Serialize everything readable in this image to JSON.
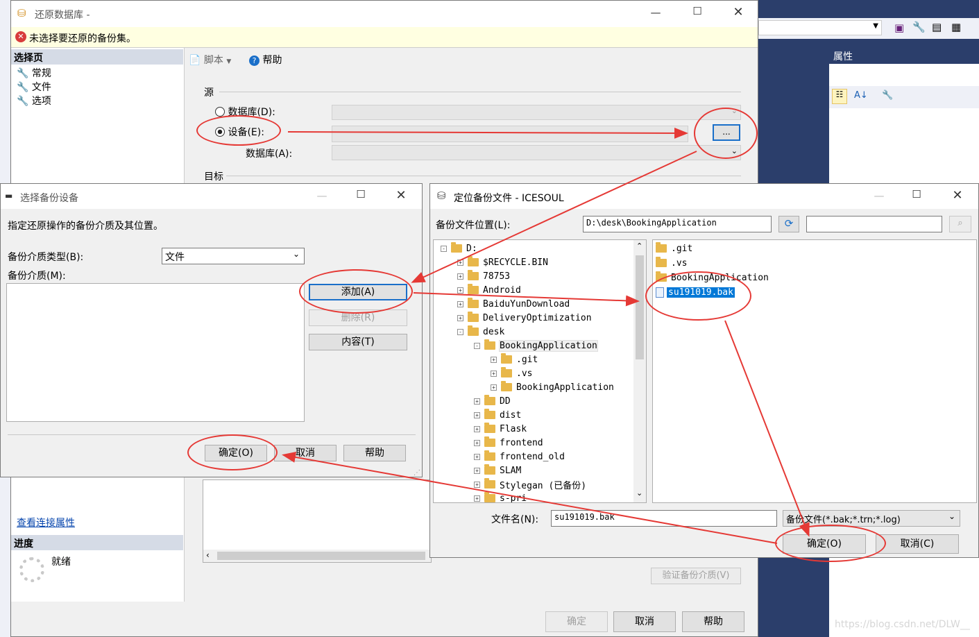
{
  "background_app": {
    "properties_label": "属性"
  },
  "restore_window": {
    "title": "还原数据库 -",
    "error_text": "未选择要还原的备份集。",
    "left_panel": {
      "header": "选择页",
      "pages": [
        "常规",
        "文件",
        "选项"
      ],
      "connection_link": "查看连接属性",
      "progress_header": "进度",
      "progress_status": "就绪"
    },
    "toolbar": {
      "script": "脚本",
      "help": "帮助"
    },
    "source_label": "源",
    "radio_database": "数据库(D):",
    "radio_device": "设备(E):",
    "database_label": "数据库(A):",
    "device_browse": "...",
    "target_label": "目标",
    "verify_button": "验证备份介质(V)",
    "ok": "确定",
    "cancel": "取消",
    "help": "帮助"
  },
  "select_device_dialog": {
    "title": "选择备份设备",
    "instruction": "指定还原操作的备份介质及其位置。",
    "media_type_label": "备份介质类型(B):",
    "media_type_value": "文件",
    "media_label": "备份介质(M):",
    "add": "添加(A)",
    "remove": "删除(R)",
    "contents": "内容(T)",
    "ok": "确定(O)",
    "cancel": "取消",
    "help": "帮助"
  },
  "locate_file_dialog": {
    "title": "定位备份文件 - ICESOUL",
    "location_label": "备份文件位置(L):",
    "location_value": "D:\\desk\\BookingApplication",
    "tree": [
      {
        "label": "D:",
        "level": 0,
        "toggle": "-"
      },
      {
        "label": "$RECYCLE.BIN",
        "level": 1,
        "toggle": "+"
      },
      {
        "label": "78753",
        "level": 1,
        "toggle": "+"
      },
      {
        "label": "Android",
        "level": 1,
        "toggle": "+"
      },
      {
        "label": "BaiduYunDownload",
        "level": 1,
        "toggle": "+"
      },
      {
        "label": "DeliveryOptimization",
        "level": 1,
        "toggle": "+"
      },
      {
        "label": "desk",
        "level": 1,
        "toggle": "-"
      },
      {
        "label": "BookingApplication",
        "level": 2,
        "toggle": "-"
      },
      {
        "label": ".git",
        "level": 3,
        "toggle": "+"
      },
      {
        "label": ".vs",
        "level": 3,
        "toggle": "+"
      },
      {
        "label": "BookingApplication",
        "level": 3,
        "toggle": "+"
      },
      {
        "label": "DD",
        "level": 2,
        "toggle": "+"
      },
      {
        "label": "dist",
        "level": 2,
        "toggle": "+"
      },
      {
        "label": "Flask",
        "level": 2,
        "toggle": "+"
      },
      {
        "label": "frontend",
        "level": 2,
        "toggle": "+"
      },
      {
        "label": "frontend_old",
        "level": 2,
        "toggle": "+"
      },
      {
        "label": "SLAM",
        "level": 2,
        "toggle": "+"
      },
      {
        "label": "Stylegan (已备份)",
        "level": 2,
        "toggle": "+"
      },
      {
        "label": "s-pri",
        "level": 2,
        "toggle": "+"
      }
    ],
    "files": [
      {
        "label": ".git",
        "kind": "folder"
      },
      {
        "label": ".vs",
        "kind": "folder"
      },
      {
        "label": "BookingApplication",
        "kind": "folder"
      },
      {
        "label": "su191019.bak",
        "kind": "file",
        "selected": true
      }
    ],
    "filename_label": "文件名(N):",
    "filename_value": "su191019.bak",
    "filter_value": "备份文件(*.bak;*.trn;*.log)",
    "ok": "确定(O)",
    "cancel": "取消(C)"
  },
  "watermark": "https://blog.csdn.net/DLW__"
}
